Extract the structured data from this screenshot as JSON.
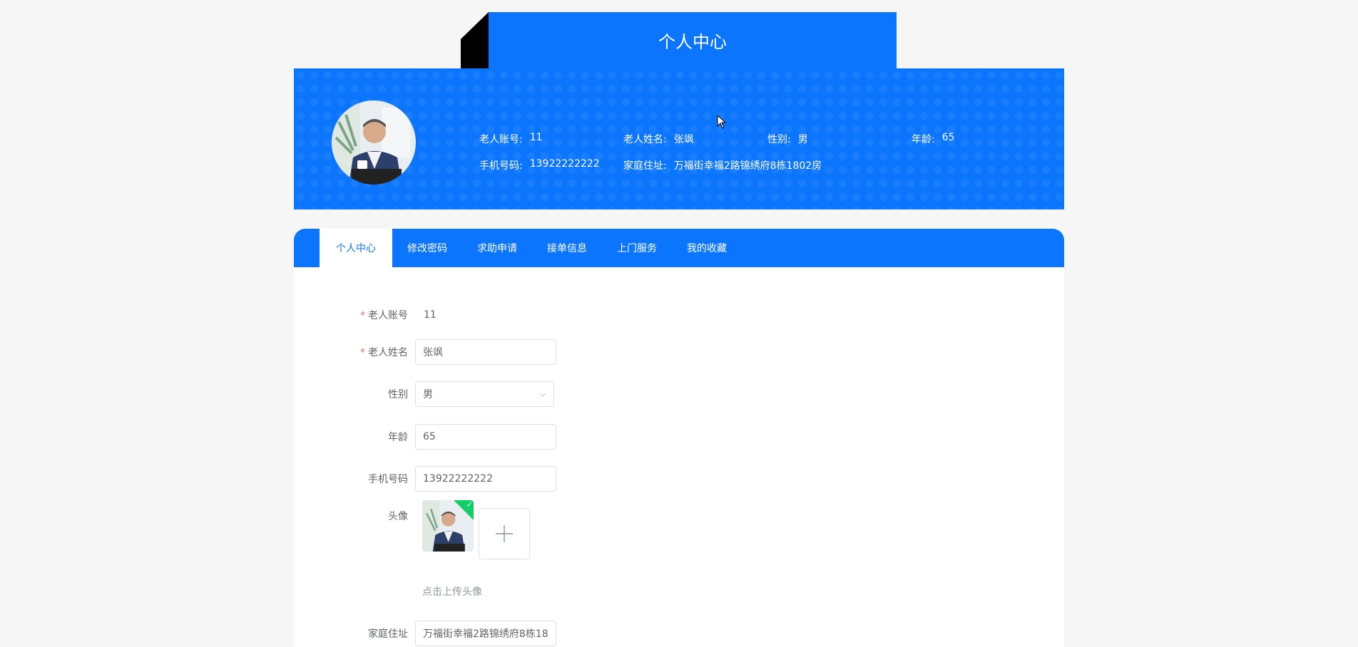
{
  "header": {
    "title": "个人中心"
  },
  "profile": {
    "account_label": "老人账号:",
    "account_value": "11",
    "name_label": "老人姓名:",
    "name_value": "张飒",
    "gender_label": "性别:",
    "gender_value": "男",
    "age_label": "年龄:",
    "age_value": "65",
    "phone_label": "手机号码:",
    "phone_value": "13922222222",
    "address_label": "家庭住址:",
    "address_value": "万福街幸福2路锦绣府8栋1802房"
  },
  "tabs": [
    {
      "label": "个人中心",
      "active": true
    },
    {
      "label": "修改密码"
    },
    {
      "label": "求助申请"
    },
    {
      "label": "接单信息"
    },
    {
      "label": "上门服务"
    },
    {
      "label": "我的收藏"
    }
  ],
  "form": {
    "account_label": "老人账号",
    "account_value": "11",
    "name_label": "老人姓名",
    "name_value": "张飒",
    "gender_label": "性别",
    "gender_value": "男",
    "age_label": "年龄",
    "age_value": "65",
    "phone_label": "手机号码",
    "phone_value": "13922222222",
    "avatar_label": "头像",
    "upload_hint": "点击上传头像",
    "address_label": "家庭住址",
    "address_value": "万福街幸福2路锦绣府8栋18",
    "required_mark": "*"
  },
  "icons": {
    "chevron": "chevron-down-icon",
    "plus": "plus-icon",
    "check": "check-icon"
  },
  "colors": {
    "primary": "#0c75fe",
    "success": "#13ce66",
    "required": "#f56c6c"
  }
}
